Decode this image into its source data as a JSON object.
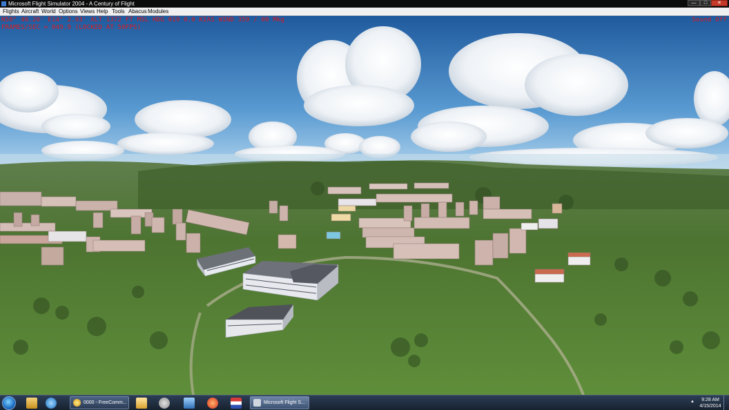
{
  "window": {
    "title": "Microsoft Flight Simulator 2004 - A Century of Flight",
    "minimize_glyph": "—",
    "maximize_glyph": "□",
    "close_glyph": "✕"
  },
  "menu": {
    "items": [
      "Flights",
      "Aircraft",
      "World",
      "Options",
      "Views",
      "Help",
      "Tools",
      "Abacus",
      "Modules"
    ]
  },
  "hud": {
    "line1": "N50° 40.20'  E14° 2.93'  ALT  1372 FT  MSL  HDG 019   0.0 KIAS  WIND 359 / 00 Mkg",
    "line2": "FRAMES/SEC = 049.9 (LOCKED AT 50FPS)",
    "sound_status": "Sound Off",
    "color": "#e01818"
  },
  "scene": {
    "sky_top": "#1f5a9e",
    "sky_horizon": "#9cc8ea",
    "ground_near": "#4f7a32",
    "ground_far": "#6f8f5a"
  },
  "taskbar": {
    "pinned_icons": [
      "windows-explorer-icon",
      "media-player-icon",
      "internet-explorer-icon"
    ],
    "tasks": [
      {
        "label": "0000 - FreeComm...",
        "icon": "freecomm-icon"
      },
      {
        "label": "Microsoft Flight S...",
        "icon": "airplane-icon"
      }
    ],
    "quick_icons": [
      "folder-icon",
      "satellite-dish-icon",
      "network-icon",
      "paint-icon",
      "flag-icon"
    ],
    "clock_time": "9:28 AM",
    "clock_date": "4/15/2014",
    "tray_arrow": "▲"
  }
}
